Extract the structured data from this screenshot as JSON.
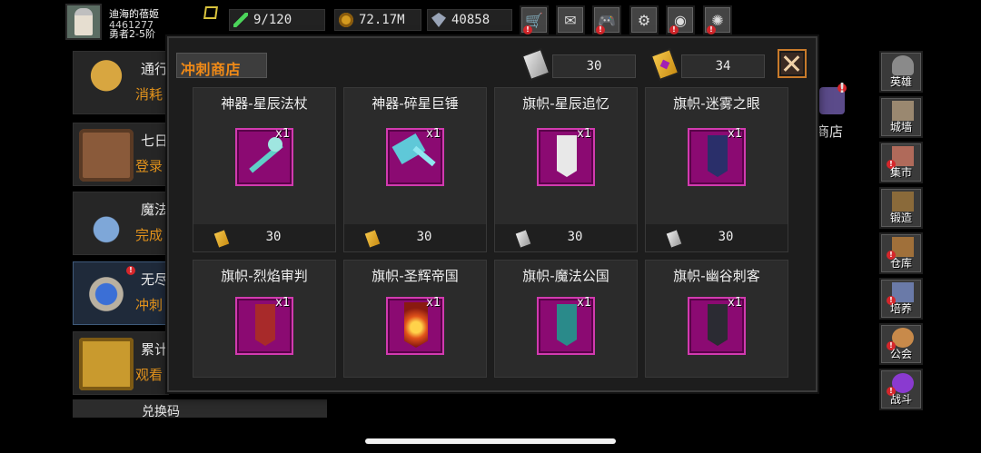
{
  "player": {
    "name": "迪海的蓓姬",
    "id": "4461277",
    "sub": "勇者2-5阶"
  },
  "resources": {
    "energy": "9/120",
    "gold": "72.17M",
    "gems": "40858"
  },
  "top_buttons": [
    {
      "icon": "shop-cart-icon"
    },
    {
      "icon": "mail-icon"
    },
    {
      "icon": "gamepad-icon"
    },
    {
      "icon": "settings-gear-icon"
    },
    {
      "icon": "color-wheel-icon"
    },
    {
      "icon": "web-icon"
    }
  ],
  "left_list": [
    {
      "title": "通行",
      "sub": "消耗"
    },
    {
      "title": "七日",
      "sub": "登录"
    },
    {
      "title": "魔法",
      "sub": "完成"
    },
    {
      "title": "无尽",
      "sub": "冲刺"
    },
    {
      "title": "累计",
      "sub": "观看"
    }
  ],
  "left_bottom": "兑换码",
  "side_menu": [
    {
      "label": "英雄",
      "badge": false
    },
    {
      "label": "城墙",
      "badge": false
    },
    {
      "label": "集市",
      "badge": true
    },
    {
      "label": "锻造",
      "badge": false
    },
    {
      "label": "仓库",
      "badge": true
    },
    {
      "label": "培养",
      "badge": true
    },
    {
      "label": "公会",
      "badge": true
    },
    {
      "label": "战斗",
      "badge": true
    }
  ],
  "bg_shop_label": "商店",
  "modal": {
    "title": "冲刺商店",
    "silver_count": "30",
    "gold_count": "34",
    "items": [
      {
        "name": "神器-星辰法杖",
        "qty": "x1",
        "currency": "gold",
        "price": "30",
        "icon": "star-staff-icon"
      },
      {
        "name": "神器-碎星巨锤",
        "qty": "x1",
        "currency": "gold",
        "price": "30",
        "icon": "star-hammer-icon"
      },
      {
        "name": "旗帜-星辰追忆",
        "qty": "x1",
        "currency": "silver",
        "price": "30",
        "icon": "white-banner-icon"
      },
      {
        "name": "旗帜-迷雾之眼",
        "qty": "x1",
        "currency": "silver",
        "price": "30",
        "icon": "navy-banner-icon"
      },
      {
        "name": "旗帜-烈焰审判",
        "qty": "x1",
        "icon": "red-banner-icon"
      },
      {
        "name": "旗帜-圣辉帝国",
        "qty": "x1",
        "icon": "flame-banner-icon"
      },
      {
        "name": "旗帜-魔法公国",
        "qty": "x1",
        "icon": "teal-banner-icon"
      },
      {
        "name": "旗帜-幽谷刺客",
        "qty": "x1",
        "icon": "dark-banner-icon"
      }
    ]
  }
}
